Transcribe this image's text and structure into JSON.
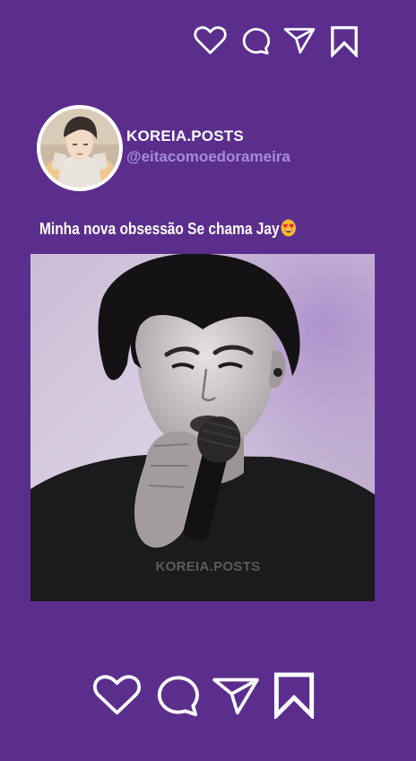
{
  "post": {
    "username": "KOREIA.POSTS",
    "handle": "@eitacomoedorameira",
    "caption": "Minha nova  obsessão Se chama Jay",
    "caption_emoji": "heart-eyes-emoji",
    "watermark": "KOREIA.POSTS"
  },
  "top_actions": [
    "heart-icon",
    "comment-icon",
    "send-icon",
    "bookmark-icon"
  ],
  "bottom_actions": [
    "heart-icon",
    "comment-icon",
    "send-icon",
    "bookmark-icon"
  ],
  "colors": {
    "background": "#5b2e8e",
    "text": "#ffffff",
    "handle": "#a48ed6",
    "emoji_face": "#f5b92e",
    "emoji_hearts": "#e0243a"
  }
}
